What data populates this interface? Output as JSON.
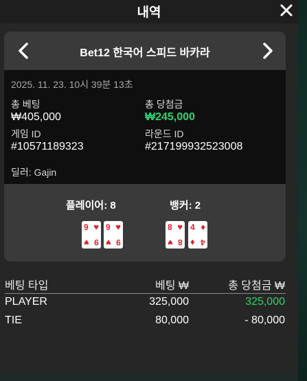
{
  "header": {
    "title": "내역",
    "close_icon": "close-icon"
  },
  "card": {
    "game_title": "Bet12 한국어 스피드 바카라",
    "prev_icon": "chevron-left-icon",
    "next_icon": "chevron-right-icon",
    "timestamp": "2025. 11. 23. 10시 39분 13초",
    "total_bet_label": "총 베팅",
    "total_bet_value": "₩405,000",
    "total_win_label": "총 당첨금",
    "total_win_value": "₩245,000",
    "game_id_label": "게임 ID",
    "game_id_value": "#10571189323",
    "round_id_label": "라운드 ID",
    "round_id_value": "#217199932523008",
    "dealer": "딜러: Gajin",
    "player_label": "플레이어: 8",
    "banker_label": "뱅커: 2",
    "player_cards": [
      {
        "rank": "9",
        "suit": "♥"
      },
      {
        "rank": "9",
        "suit": "♥"
      }
    ],
    "banker_cards": [
      {
        "rank": "8",
        "suit": "♥"
      },
      {
        "rank": "4",
        "suit": "♦"
      }
    ]
  },
  "bets": {
    "headers": [
      "베팅 타입",
      "베팅 ₩",
      "총 당첨금 ₩"
    ],
    "rows": [
      {
        "type": "PLAYER",
        "bet": "325,000",
        "win": "325,000",
        "win_positive": true
      },
      {
        "type": "TIE",
        "bet": "80,000",
        "win": "- 80,000",
        "win_positive": false
      }
    ]
  },
  "colors": {
    "accent_green": "#2fd36f",
    "card_red": "#e11d2a",
    "panel": "#3a3a3a",
    "details_bg": "#0f0f0f"
  }
}
